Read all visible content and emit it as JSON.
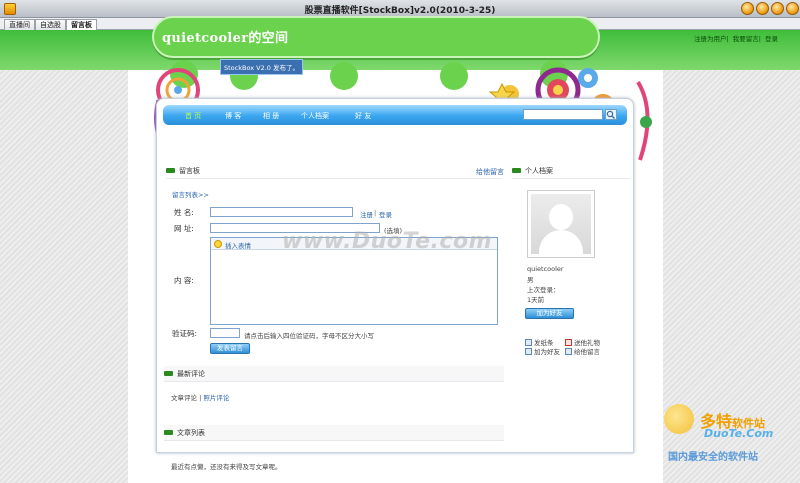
{
  "window": {
    "title": "股票直播软件[StockBox]v2.0(2010-3-25)"
  },
  "tabs": [
    {
      "label": "直播间",
      "active": false
    },
    {
      "label": "自选股",
      "active": false
    },
    {
      "label": "留言板",
      "active": true
    }
  ],
  "top_links": [
    "注册为用户",
    "我要留言",
    "登录"
  ],
  "blog": {
    "name": "quietcooler的空间",
    "slogan": "StockBox V2.0 发布了。"
  },
  "nav": {
    "items": [
      "首 页",
      "博 客",
      "相 册",
      "个人档案",
      "好 友"
    ],
    "active_index": 0,
    "search_placeholder": ""
  },
  "guestbook": {
    "section_title": "留言板",
    "manage_link": "给他留言",
    "list_link": "留言列表>>",
    "name_label": "姓 名:",
    "site_label": "网 址:",
    "content_label": "内 容:",
    "captcha_label": "验证码:",
    "register_link": "注册",
    "login_link": "登录",
    "optional_hint": "(选填)",
    "emoticon_label": "插入表情",
    "captcha_hint": "请点击后输入四位验证码，字母不区分大小写",
    "submit_label": "发表留言"
  },
  "profile": {
    "section_title": "个人档案",
    "username": "quietcooler",
    "gender": "男",
    "last_login_label": "上次登录：",
    "last_login_value": "1天前",
    "add_friend_label": "加为好友",
    "actions": [
      "发纸条",
      "送他礼物",
      "加为好友",
      "给他留言"
    ]
  },
  "comments": {
    "section_title": "最新评论",
    "article_link": "文章评论",
    "photo_link": "照片评论"
  },
  "articles": {
    "section_title": "文章列表",
    "empty_text": "最近有点懒，还没有来得及写文章呢。"
  },
  "watermark": {
    "text": "www.DuoTe.com",
    "brand": "多特",
    "brand_suffix": "软件站",
    "domain": "DuoTe.Com",
    "tagline": "国内最安全的软件站"
  },
  "colors": {
    "green": "#3fbd3a",
    "nav_blue": "#2b8fd8",
    "link": "#2a64a8",
    "title_orange": "#f0a21d"
  }
}
